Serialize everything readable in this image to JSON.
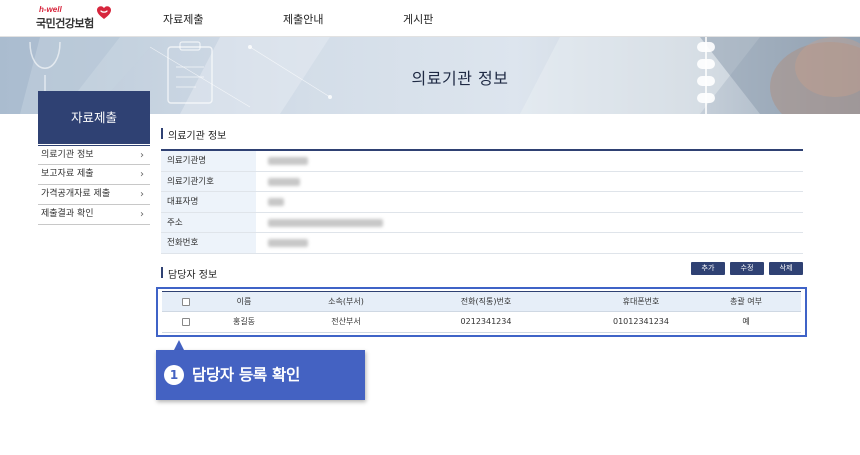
{
  "header": {
    "logo_brand": "h-well",
    "logo_name": "국민건강보험",
    "nav": [
      "자료제출",
      "제출안내",
      "게시판"
    ]
  },
  "banner": {
    "title": "의료기관 정보"
  },
  "sidebar": {
    "heading": "자료제출",
    "items": [
      {
        "label": "의료기관 정보"
      },
      {
        "label": "보고자료 제출"
      },
      {
        "label": "가격공개자료 제출"
      },
      {
        "label": "제출결과 확인"
      }
    ]
  },
  "hospital_info": {
    "title": "의료기관 정보",
    "fields": [
      {
        "label": "의료기관명"
      },
      {
        "label": "의료기관기호"
      },
      {
        "label": "대표자명"
      },
      {
        "label": "주소"
      },
      {
        "label": "전화번호"
      }
    ]
  },
  "contacts": {
    "title": "담당자 정보",
    "buttons": {
      "add": "추가",
      "edit": "수정",
      "delete": "삭제"
    },
    "columns": [
      "이름",
      "소속(부서)",
      "전화(직통)번호",
      "휴대폰번호",
      "총괄 여부"
    ],
    "rows": [
      {
        "name": "홍길동",
        "dept": "전산부서",
        "phone": "0212341234",
        "mobile": "01012341234",
        "chief": "예"
      }
    ]
  },
  "callout": {
    "number": "1",
    "text": "담당자 등록 확인"
  },
  "colors": {
    "primary": "#2f4173",
    "highlight": "#4462c2",
    "table_label_bg": "#edf3fa",
    "logo_red": "#d7263d"
  }
}
